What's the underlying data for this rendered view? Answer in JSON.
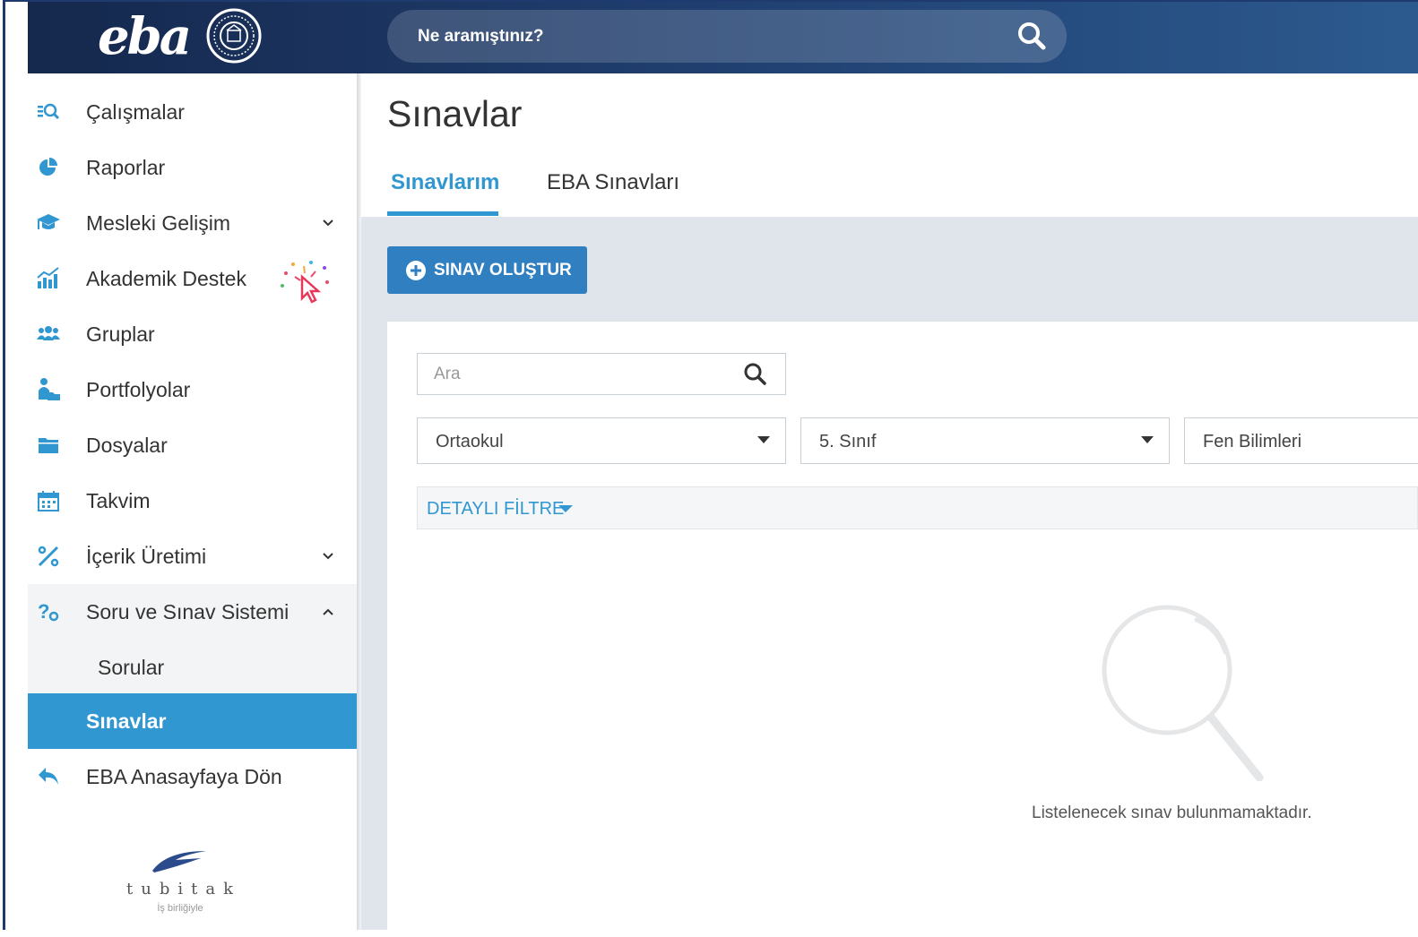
{
  "header": {
    "logo": "eba",
    "search_placeholder": "Ne aramıştınız?"
  },
  "sidebar": {
    "items": [
      {
        "label": "Çalışmalar",
        "icon": "search-list-icon"
      },
      {
        "label": "Raporlar",
        "icon": "pie-chart-icon"
      },
      {
        "label": "Mesleki Gelişim",
        "icon": "graduation-cap-icon",
        "expandable": true
      },
      {
        "label": "Akademik Destek",
        "icon": "bar-chart-icon",
        "badge": "new-click-badge"
      },
      {
        "label": "Gruplar",
        "icon": "users-icon"
      },
      {
        "label": "Portfolyolar",
        "icon": "user-folder-icon"
      },
      {
        "label": "Dosyalar",
        "icon": "folder-icon"
      },
      {
        "label": "Takvim",
        "icon": "calendar-icon"
      },
      {
        "label": "İçerik Üretimi",
        "icon": "edit-tools-icon",
        "expandable": true
      },
      {
        "label": "Soru ve Sınav Sistemi",
        "icon": "question-icon",
        "expanded": true
      },
      {
        "label": "Sorular",
        "sub": true
      },
      {
        "label": "Sınavlar",
        "sub": true,
        "active": true
      },
      {
        "label": "EBA Anasayfaya Dön",
        "icon": "reply-icon"
      }
    ],
    "sponsor": {
      "name": "tubitak",
      "caption": "İş birliğiyle"
    }
  },
  "main": {
    "title": "Sınavlar",
    "tabs": [
      {
        "label": "Sınavlarım",
        "active": true
      },
      {
        "label": "EBA Sınavları",
        "active": false
      }
    ],
    "create_button": "SINAV OLUŞTUR",
    "filters": {
      "search_placeholder": "Ara",
      "level": "Ortaokul",
      "grade": "5. Sınıf",
      "subject": "Fen Bilimleri",
      "detail_filter": "DETAYLI FİLTRE"
    },
    "empty_message": "Listelenecek sınav bulunmamaktadır."
  },
  "colors": {
    "accent": "#3097d1",
    "button": "#2f7fc1",
    "header_dark": "#15284d",
    "content_bg": "#dfe5ea"
  }
}
